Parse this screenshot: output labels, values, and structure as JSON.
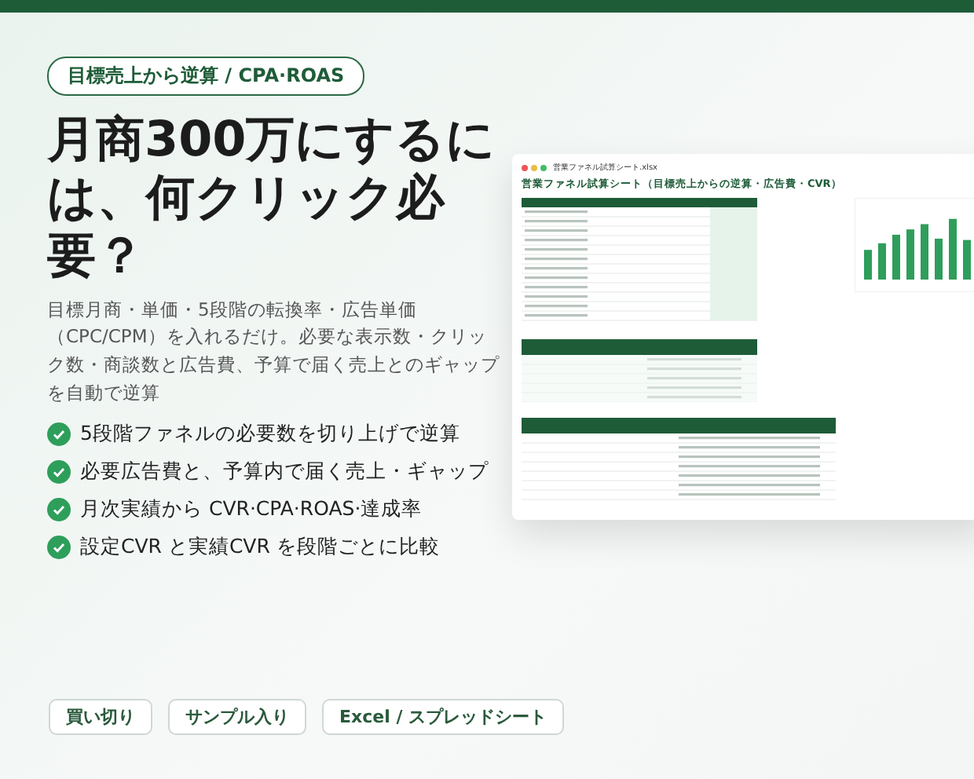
{
  "badge": "目標売上から逆算 / CPA·ROAS",
  "headline": "月商300万にするには、何クリック必要？",
  "description": "目標月商・単価・5段階の転換率・広告単価（CPC/CPM）を入れるだけ。必要な表示数・クリック数・商談数と広告費、予算で届く売上とのギャップを自動で逆算",
  "features": [
    {
      "text": "5段階ファネルの必要数を切り上げで逆算",
      "checked": true
    },
    {
      "text": "必要広告費と、予算内で届く売上・ギャップ",
      "checked": true
    },
    {
      "text": "月次実績から CVR·CPA·ROAS·達成率",
      "checked": true
    },
    {
      "text": "設定CVR と実績CVR を段階ごとに比較",
      "checked": true
    }
  ],
  "preview": {
    "filename": "営業ファネル試算シート.xlsx",
    "title": "営業ファネル試算シート（目標売上からの逆算・広告費・CVR）"
  },
  "tags": [
    "買い切り",
    "サンプル入り",
    "Excel / スプレッドシート"
  ]
}
